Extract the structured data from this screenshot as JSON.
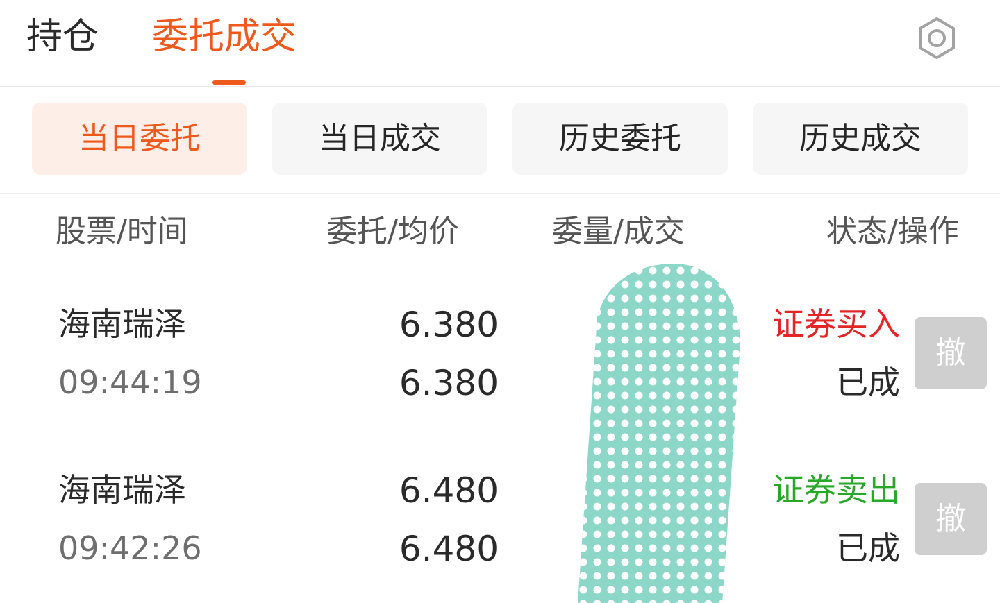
{
  "top_tabs": {
    "holdings": "持仓",
    "orders_trades": "委托成交"
  },
  "sub_tabs": [
    "当日委托",
    "当日成交",
    "历史委托",
    "历史成交"
  ],
  "table_header": {
    "stock_time": "股票/时间",
    "order_avg": "委托/均价",
    "qty_filled": "委量/成交",
    "status_action": "状态/操作"
  },
  "rows": [
    {
      "name": "海南瑞泽",
      "time": "09:44:19",
      "order_price": "6.380",
      "avg_price": "6.380",
      "type": "证券买入",
      "status": "已成",
      "action": "撤"
    },
    {
      "name": "海南瑞泽",
      "time": "09:42:26",
      "order_price": "6.480",
      "avg_price": "6.480",
      "type": "证券卖出",
      "status": "已成",
      "action": "撤"
    }
  ],
  "colors": {
    "accent": "#ee5a1d",
    "buy": "#e22626",
    "sell": "#27a827",
    "patch": "#8dd7c9"
  },
  "icons": {
    "settings": "gear-icon"
  }
}
